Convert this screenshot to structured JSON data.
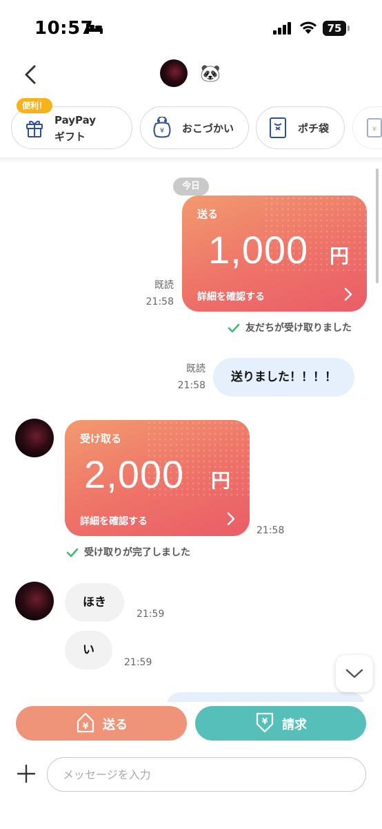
{
  "status_bar": {
    "time": "10:57",
    "battery": "75"
  },
  "header": {
    "name_emoji": "🐼"
  },
  "chips": [
    {
      "label_line1": "PayPay",
      "label_line2": "ギフト",
      "badge": "便利！"
    },
    {
      "label": "おこづかい"
    },
    {
      "label": "ポチ袋"
    }
  ],
  "chat": {
    "date": "今日",
    "messages": [
      {
        "type": "money",
        "direction": "out",
        "label": "送る",
        "amount": "1,000",
        "currency": "円",
        "detail": "詳細を確認する",
        "read": "既読",
        "time": "21:58",
        "status": "友だちが受け取りました"
      },
      {
        "type": "text",
        "direction": "out",
        "text": "送りました！！！！",
        "read": "既読",
        "time": "21:58"
      },
      {
        "type": "money",
        "direction": "in",
        "label": "受け取る",
        "amount": "2,000",
        "currency": "円",
        "detail": "詳細を確認する",
        "time": "21:58",
        "status": "受け取りが完了しました"
      },
      {
        "type": "text",
        "direction": "in",
        "text": "ほき",
        "time": "21:59"
      },
      {
        "type": "text",
        "direction": "in",
        "text": "い",
        "time": "21:59"
      }
    ]
  },
  "actions": {
    "send_label": "送る",
    "request_label": "請求"
  },
  "input": {
    "placeholder": "メッセージを入力"
  },
  "colors": {
    "send": "#ef9478",
    "request": "#56bfba",
    "card_start": "#f29a6f",
    "card_end": "#ea5d68",
    "check": "#3cb96a"
  }
}
